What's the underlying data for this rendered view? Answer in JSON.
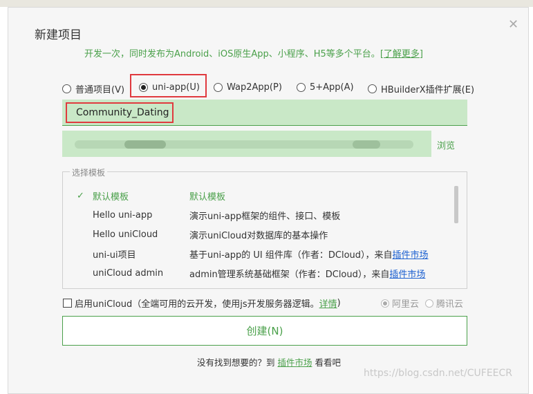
{
  "dialog": {
    "title": "新建项目",
    "close_icon": "close-icon",
    "subtitle": "开发一次，同时发布为Android、iOS原生App、小程序、H5等多个平台。",
    "subtitle_link": "[了解更多]"
  },
  "project_types": [
    {
      "label": "普通项目(V)",
      "selected": false
    },
    {
      "label": "uni-app(U)",
      "selected": true
    },
    {
      "label": "Wap2App(P)",
      "selected": false
    },
    {
      "label": "5+App(A)",
      "selected": false
    },
    {
      "label": "HBuilderX插件扩展(E)",
      "selected": false
    }
  ],
  "project_name": "Community_Dating",
  "browse_label": "浏览",
  "templates": {
    "legend": "选择模板",
    "items": [
      {
        "name": "默认模板",
        "desc": "默认模板",
        "link": "",
        "selected": true
      },
      {
        "name": "Hello uni-app",
        "desc": "演示uni-app框架的组件、接口、模板",
        "link": "",
        "selected": false
      },
      {
        "name": "Hello uniCloud",
        "desc": "演示uniCloud对数据库的基本操作",
        "link": "",
        "selected": false
      },
      {
        "name": "uni-ui项目",
        "desc": "基于uni-app的 UI 组件库（作者：DCloud），来自",
        "link": "插件市场",
        "selected": false
      },
      {
        "name": "uniCloud admin",
        "desc": "admin管理系统基础框架（作者：DCloud），来自",
        "link": "插件市场",
        "selected": false
      }
    ]
  },
  "unicloud": {
    "label": "启用uniCloud（全端可用的云开发，使用js开发服务器逻辑。",
    "link": "详情",
    "close": ")",
    "providers": [
      {
        "label": "阿里云",
        "selected": true
      },
      {
        "label": "腾讯云",
        "selected": false
      }
    ]
  },
  "create_button": "创建(N)",
  "footer": {
    "prefix": "没有找到想要的？到 ",
    "link": "插件市场",
    "suffix": " 看看吧"
  },
  "watermark": "https://blog.csdn.net/CUFEECR",
  "colors": {
    "accent": "#4aa04a",
    "field_bg": "#c9e8c7",
    "highlight": "#e0393e",
    "link_blue": "#1a5fd0"
  }
}
